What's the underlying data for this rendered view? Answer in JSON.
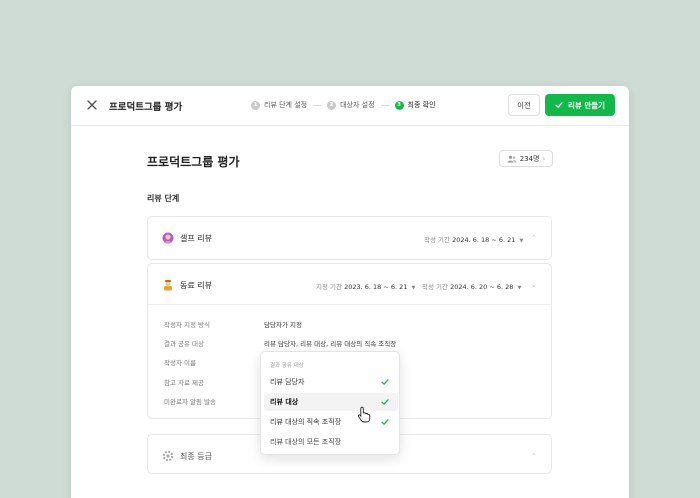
{
  "header": {
    "title": "프로덕트그룹 평가",
    "steps": [
      {
        "num": "1",
        "label": "리뷰 단계 설정"
      },
      {
        "num": "2",
        "label": "대상자 설정"
      },
      {
        "num": "3",
        "label": "최종 확인"
      }
    ],
    "prev_label": "이전",
    "create_label": "리뷰 만들기"
  },
  "main": {
    "title": "프로덕트그룹 평가",
    "members_count": "234명",
    "section_title": "리뷰 단계"
  },
  "stages": {
    "self": {
      "name": "셀프 리뷰",
      "write_period_label": "작성 기간",
      "write_period": "2024. 6. 18 ~ 6. 21"
    },
    "peer": {
      "name": "동료 리뷰",
      "assign_period_label": "지정 기간",
      "assign_period": "2023. 6. 18 ~ 6. 21",
      "write_period_label": "작성 기간",
      "write_period": "2024. 6. 20 ~ 6. 28",
      "fields": [
        {
          "label": "작성자 지정 방식",
          "value": "담당자가 지정"
        },
        {
          "label": "결과 공유 대상",
          "value": "리뷰 담당자, 리뷰 대상, 리뷰 대상의 직속 조직장"
        },
        {
          "label": "작성자 이름",
          "value": ""
        },
        {
          "label": "참고 자료 제공",
          "value": ""
        },
        {
          "label": "미완료자 알림 발송",
          "value": ""
        }
      ]
    },
    "final": {
      "name": "최종 등급"
    }
  },
  "dropdown": {
    "title": "결과 공유 대상",
    "options": [
      {
        "label": "리뷰 담당자",
        "checked": true
      },
      {
        "label": "리뷰 대상",
        "checked": true
      },
      {
        "label": "리뷰 대상의 직속 조직장",
        "checked": true
      },
      {
        "label": "리뷰 대상의 모든 조직장",
        "checked": false
      }
    ]
  },
  "colors": {
    "accent": "#12b848",
    "background": "#cfdcd6"
  }
}
